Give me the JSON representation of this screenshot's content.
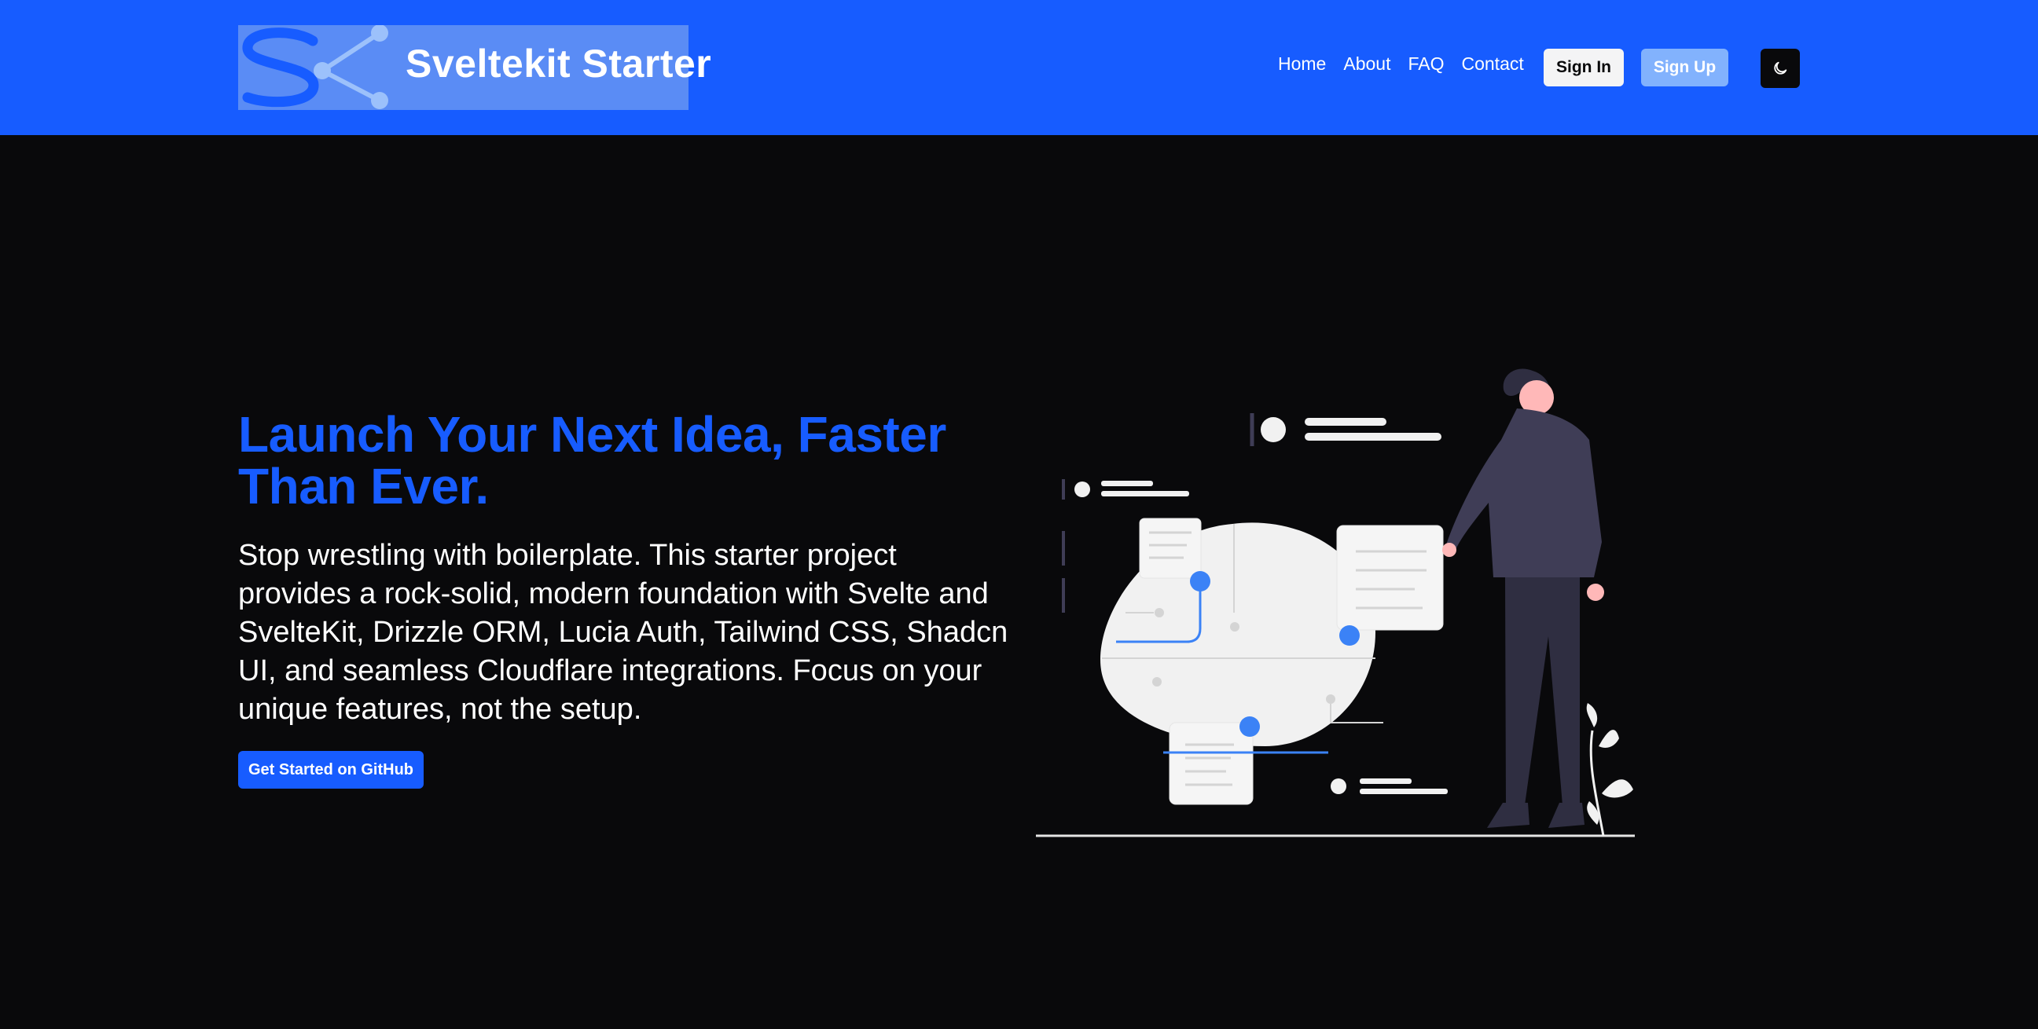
{
  "header": {
    "brand": "Sveltekit Starter",
    "nav": [
      {
        "label": "Home"
      },
      {
        "label": "About"
      },
      {
        "label": "FAQ"
      },
      {
        "label": "Contact"
      }
    ],
    "sign_in_label": "Sign In",
    "sign_up_label": "Sign Up",
    "theme_toggle_icon": "moon-icon"
  },
  "hero": {
    "title": "Launch Your Next Idea, Faster Than Ever.",
    "description": "Stop wrestling with boilerplate. This starter project provides a rock-solid, modern foundation with Svelte and SvelteKit, Drizzle ORM, Lucia Auth, Tailwind CSS, Shadcn UI, and seamless Cloudflare integrations. Focus on your unique features, not the setup.",
    "cta_label": "Get Started on GitHub"
  },
  "colors": {
    "brand": "#175cff",
    "background": "#09090b",
    "accent": "#3b82f6",
    "sign_up": "#82b2fd"
  }
}
